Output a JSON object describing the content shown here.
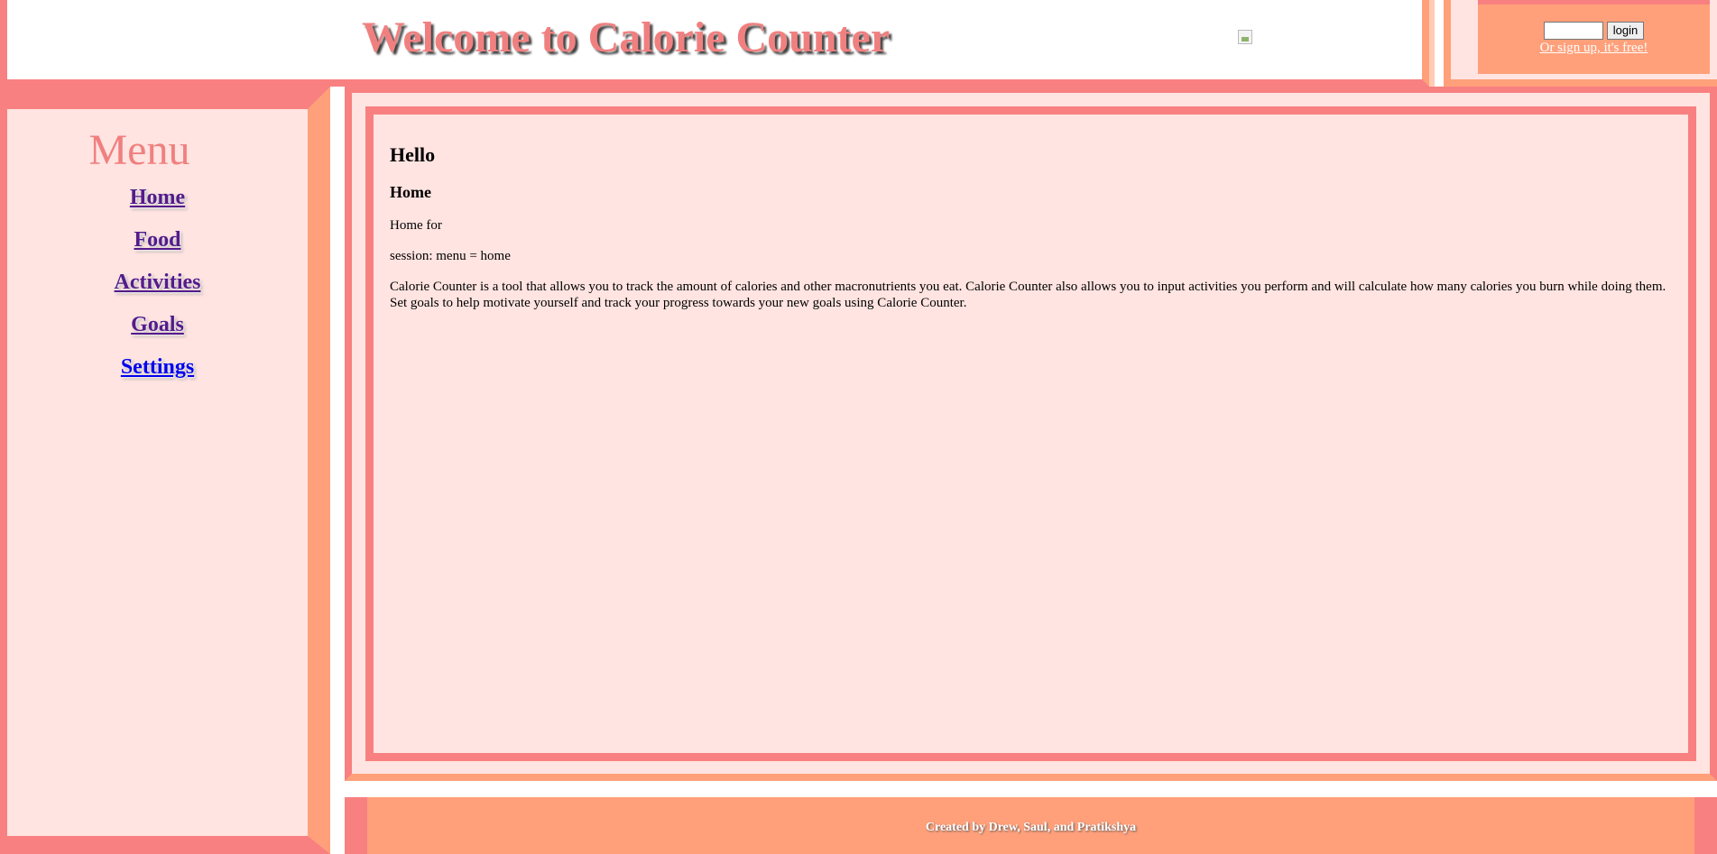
{
  "header": {
    "title": "Welcome to Calorie Counter",
    "logo_image": "broken-image-icon"
  },
  "login": {
    "username_value": "",
    "button_label": "login",
    "signup_link": "Or sign up, it's free!"
  },
  "sidebar": {
    "title": "Menu",
    "items": [
      {
        "label": "Home"
      },
      {
        "label": "Food"
      },
      {
        "label": "Activities"
      },
      {
        "label": "Goals"
      },
      {
        "label": "Settings"
      }
    ]
  },
  "main": {
    "greeting": "Hello",
    "heading": "Home",
    "home_for": "Home for",
    "session": "session: menu = home",
    "description": "Calorie Counter is a tool that allows you to track the amount of calories and other macronutrients you eat. Calorie Counter also allows you to input activities you perform and will calculate how many calories you burn while doing them. Set goals to help motivate yourself and track your progress towards your new goals using Calorie Counter."
  },
  "footer": {
    "credits": "Created by Drew, Saul, and Pratikshya"
  },
  "colors": {
    "salmon": "#f88080",
    "light_salmon": "#ffa07a",
    "misty_rose": "#ffe4e1",
    "title_color": "#f08080",
    "visited_link": "#551a8b",
    "unvisited_link": "#0000ee"
  }
}
